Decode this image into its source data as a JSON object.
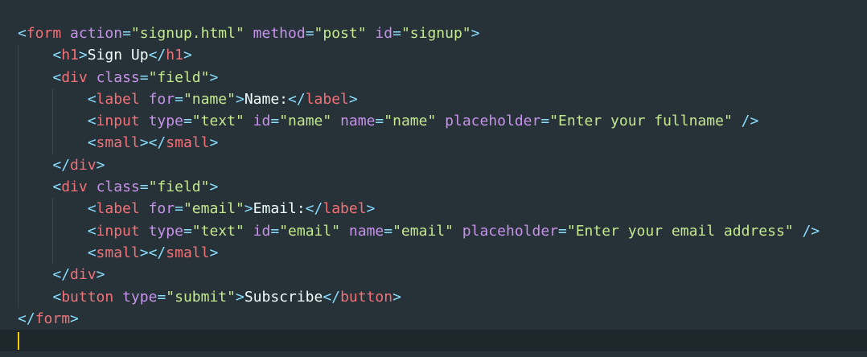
{
  "editor": {
    "colors": {
      "background": "#263238",
      "bracket": "#89ddff",
      "tag": "#f07178",
      "attribute": "#c792ea",
      "string": "#c3e88d",
      "text": "#eeffff",
      "caret": "#ffcc00"
    },
    "lines": [
      {
        "indent": 0,
        "tokens": [
          {
            "t": "bracket",
            "v": "<"
          },
          {
            "t": "tag",
            "v": "form"
          },
          {
            "t": "text",
            "v": " "
          },
          {
            "t": "attr",
            "v": "action"
          },
          {
            "t": "eq",
            "v": "="
          },
          {
            "t": "str",
            "v": "\"signup.html\""
          },
          {
            "t": "text",
            "v": " "
          },
          {
            "t": "attr",
            "v": "method"
          },
          {
            "t": "eq",
            "v": "="
          },
          {
            "t": "str",
            "v": "\"post\""
          },
          {
            "t": "text",
            "v": " "
          },
          {
            "t": "attr",
            "v": "id"
          },
          {
            "t": "eq",
            "v": "="
          },
          {
            "t": "str",
            "v": "\"signup\""
          },
          {
            "t": "bracket",
            "v": ">"
          }
        ]
      },
      {
        "indent": 1,
        "tokens": [
          {
            "t": "bracket",
            "v": "<"
          },
          {
            "t": "tag",
            "v": "h1"
          },
          {
            "t": "bracket",
            "v": ">"
          },
          {
            "t": "text",
            "v": "Sign Up"
          },
          {
            "t": "bracket",
            "v": "</"
          },
          {
            "t": "tag",
            "v": "h1"
          },
          {
            "t": "bracket",
            "v": ">"
          }
        ]
      },
      {
        "indent": 1,
        "tokens": [
          {
            "t": "bracket",
            "v": "<"
          },
          {
            "t": "tag",
            "v": "div"
          },
          {
            "t": "text",
            "v": " "
          },
          {
            "t": "attr",
            "v": "class"
          },
          {
            "t": "eq",
            "v": "="
          },
          {
            "t": "str",
            "v": "\"field\""
          },
          {
            "t": "bracket",
            "v": ">"
          }
        ]
      },
      {
        "indent": 2,
        "tokens": [
          {
            "t": "bracket",
            "v": "<"
          },
          {
            "t": "tag",
            "v": "label"
          },
          {
            "t": "text",
            "v": " "
          },
          {
            "t": "attr",
            "v": "for"
          },
          {
            "t": "eq",
            "v": "="
          },
          {
            "t": "str",
            "v": "\"name\""
          },
          {
            "t": "bracket",
            "v": ">"
          },
          {
            "t": "text",
            "v": "Name:"
          },
          {
            "t": "bracket",
            "v": "</"
          },
          {
            "t": "tag",
            "v": "label"
          },
          {
            "t": "bracket",
            "v": ">"
          }
        ]
      },
      {
        "indent": 2,
        "tokens": [
          {
            "t": "bracket",
            "v": "<"
          },
          {
            "t": "tag",
            "v": "input"
          },
          {
            "t": "text",
            "v": " "
          },
          {
            "t": "attr",
            "v": "type"
          },
          {
            "t": "eq",
            "v": "="
          },
          {
            "t": "str",
            "v": "\"text\""
          },
          {
            "t": "text",
            "v": " "
          },
          {
            "t": "attr",
            "v": "id"
          },
          {
            "t": "eq",
            "v": "="
          },
          {
            "t": "str",
            "v": "\"name\""
          },
          {
            "t": "text",
            "v": " "
          },
          {
            "t": "attr",
            "v": "name"
          },
          {
            "t": "eq",
            "v": "="
          },
          {
            "t": "str",
            "v": "\"name\""
          },
          {
            "t": "text",
            "v": " "
          },
          {
            "t": "attr",
            "v": "placeholder"
          },
          {
            "t": "eq",
            "v": "="
          },
          {
            "t": "str",
            "v": "\"Enter your fullname\""
          },
          {
            "t": "text",
            "v": " "
          },
          {
            "t": "bracket",
            "v": "/>"
          }
        ]
      },
      {
        "indent": 2,
        "tokens": [
          {
            "t": "bracket",
            "v": "<"
          },
          {
            "t": "tag",
            "v": "small"
          },
          {
            "t": "bracket",
            "v": ">"
          },
          {
            "t": "bracket",
            "v": "</"
          },
          {
            "t": "tag",
            "v": "small"
          },
          {
            "t": "bracket",
            "v": ">"
          }
        ]
      },
      {
        "indent": 1,
        "tokens": [
          {
            "t": "bracket",
            "v": "</"
          },
          {
            "t": "tag",
            "v": "div"
          },
          {
            "t": "bracket",
            "v": ">"
          }
        ]
      },
      {
        "indent": 1,
        "tokens": [
          {
            "t": "bracket",
            "v": "<"
          },
          {
            "t": "tag",
            "v": "div"
          },
          {
            "t": "text",
            "v": " "
          },
          {
            "t": "attr",
            "v": "class"
          },
          {
            "t": "eq",
            "v": "="
          },
          {
            "t": "str",
            "v": "\"field\""
          },
          {
            "t": "bracket",
            "v": ">"
          }
        ]
      },
      {
        "indent": 2,
        "tokens": [
          {
            "t": "bracket",
            "v": "<"
          },
          {
            "t": "tag",
            "v": "label"
          },
          {
            "t": "text",
            "v": " "
          },
          {
            "t": "attr",
            "v": "for"
          },
          {
            "t": "eq",
            "v": "="
          },
          {
            "t": "str",
            "v": "\"email\""
          },
          {
            "t": "bracket",
            "v": ">"
          },
          {
            "t": "text",
            "v": "Email:"
          },
          {
            "t": "bracket",
            "v": "</"
          },
          {
            "t": "tag",
            "v": "label"
          },
          {
            "t": "bracket",
            "v": ">"
          }
        ]
      },
      {
        "indent": 2,
        "tokens": [
          {
            "t": "bracket",
            "v": "<"
          },
          {
            "t": "tag",
            "v": "input"
          },
          {
            "t": "text",
            "v": " "
          },
          {
            "t": "attr",
            "v": "type"
          },
          {
            "t": "eq",
            "v": "="
          },
          {
            "t": "str",
            "v": "\"text\""
          },
          {
            "t": "text",
            "v": " "
          },
          {
            "t": "attr",
            "v": "id"
          },
          {
            "t": "eq",
            "v": "="
          },
          {
            "t": "str",
            "v": "\"email\""
          },
          {
            "t": "text",
            "v": " "
          },
          {
            "t": "attr",
            "v": "name"
          },
          {
            "t": "eq",
            "v": "="
          },
          {
            "t": "str",
            "v": "\"email\""
          },
          {
            "t": "text",
            "v": " "
          },
          {
            "t": "attr",
            "v": "placeholder"
          },
          {
            "t": "eq",
            "v": "="
          },
          {
            "t": "str",
            "v": "\"Enter your email address\""
          },
          {
            "t": "text",
            "v": " "
          },
          {
            "t": "bracket",
            "v": "/>"
          }
        ]
      },
      {
        "indent": 2,
        "tokens": [
          {
            "t": "bracket",
            "v": "<"
          },
          {
            "t": "tag",
            "v": "small"
          },
          {
            "t": "bracket",
            "v": ">"
          },
          {
            "t": "bracket",
            "v": "</"
          },
          {
            "t": "tag",
            "v": "small"
          },
          {
            "t": "bracket",
            "v": ">"
          }
        ]
      },
      {
        "indent": 1,
        "tokens": [
          {
            "t": "bracket",
            "v": "</"
          },
          {
            "t": "tag",
            "v": "div"
          },
          {
            "t": "bracket",
            "v": ">"
          }
        ]
      },
      {
        "indent": 1,
        "tokens": [
          {
            "t": "bracket",
            "v": "<"
          },
          {
            "t": "tag",
            "v": "button"
          },
          {
            "t": "text",
            "v": " "
          },
          {
            "t": "attr",
            "v": "type"
          },
          {
            "t": "eq",
            "v": "="
          },
          {
            "t": "str",
            "v": "\"submit\""
          },
          {
            "t": "bracket",
            "v": ">"
          },
          {
            "t": "text",
            "v": "Subscribe"
          },
          {
            "t": "bracket",
            "v": "</"
          },
          {
            "t": "tag",
            "v": "button"
          },
          {
            "t": "bracket",
            "v": ">"
          }
        ]
      },
      {
        "indent": 0,
        "tokens": [
          {
            "t": "bracket",
            "v": "</"
          },
          {
            "t": "tag",
            "v": "form"
          },
          {
            "t": "bracket",
            "v": ">"
          }
        ]
      }
    ]
  }
}
